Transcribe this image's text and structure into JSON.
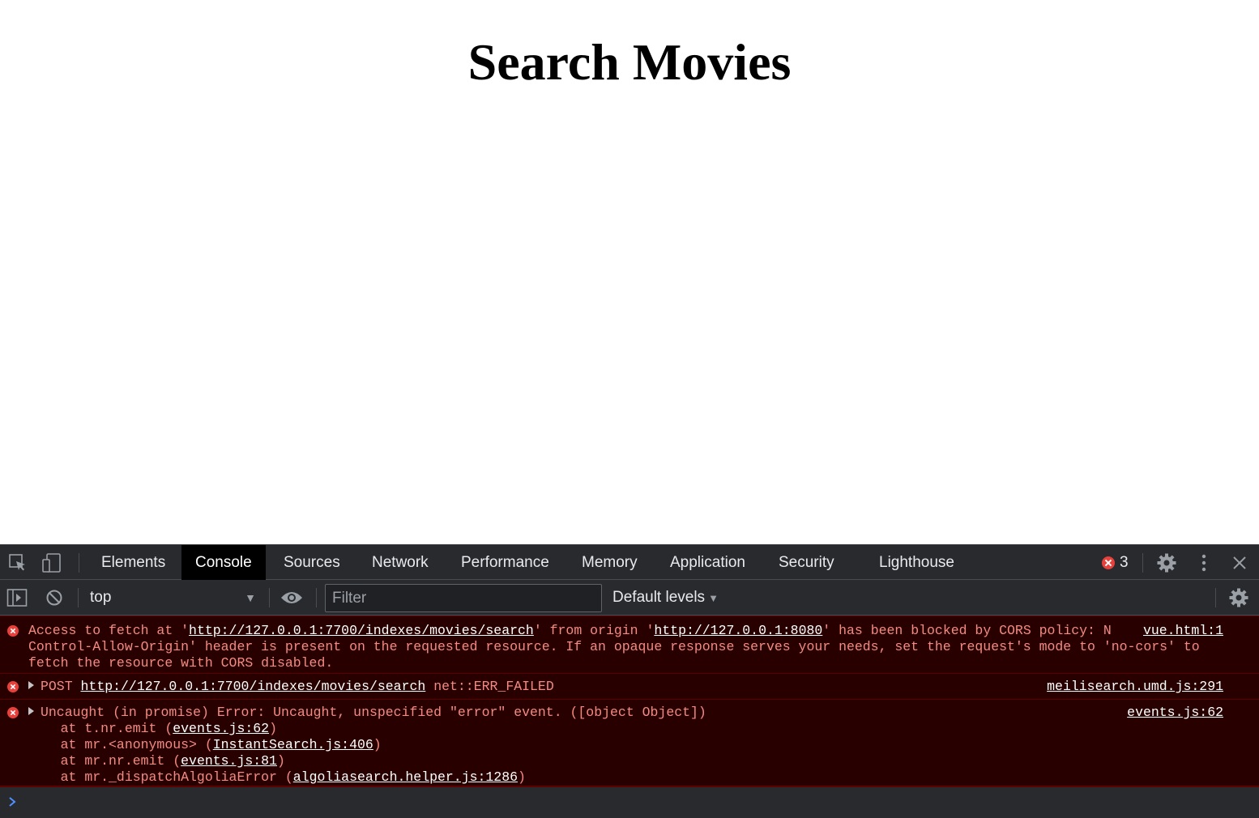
{
  "page": {
    "title": "Search Movies"
  },
  "devtools": {
    "tabs": [
      {
        "label": "Elements"
      },
      {
        "label": "Console"
      },
      {
        "label": "Sources"
      },
      {
        "label": "Network"
      },
      {
        "label": "Performance"
      },
      {
        "label": "Memory"
      },
      {
        "label": "Application"
      },
      {
        "label": "Security"
      },
      {
        "label": "Lighthouse"
      }
    ],
    "active_tab": "Console",
    "error_count": "3",
    "toolbar": {
      "context": "top",
      "filter_placeholder": "Filter",
      "levels": "Default levels"
    },
    "messages": [
      {
        "pre": "Access to fetch at '",
        "url1": "http://127.0.0.1:7700/indexes/movies/search",
        "mid": "' from origin '",
        "url2": "http://127.0.0.1:8080",
        "post": "' has been blocked by CORS policy: No 'Access-Control-Allow-Origin' header is present on the requested resource. If an opaque response serves your needs, set the request's mode to 'no-cors' to fetch the resource with CORS disabled.",
        "source": "vue.html:1"
      },
      {
        "method": "POST",
        "url": "http://127.0.0.1:7700/indexes/movies/search",
        "status": "net::ERR_FAILED",
        "source": "meilisearch.umd.js:291"
      },
      {
        "text": "Uncaught (in promise) Error: Uncaught, unspecified \"error\" event. ([object Object])",
        "source": "events.js:62",
        "stack": [
          {
            "pre": "    at t.nr.emit (",
            "link": "events.js:62",
            "post": ")"
          },
          {
            "pre": "    at mr.<anonymous> (",
            "link": "InstantSearch.js:406",
            "post": ")"
          },
          {
            "pre": "    at mr.nr.emit (",
            "link": "events.js:81",
            "post": ")"
          },
          {
            "pre": "    at mr._dispatchAlgoliaError (",
            "link": "algoliasearch.helper.js:1286",
            "post": ")"
          }
        ]
      }
    ],
    "prompt": ">"
  }
}
